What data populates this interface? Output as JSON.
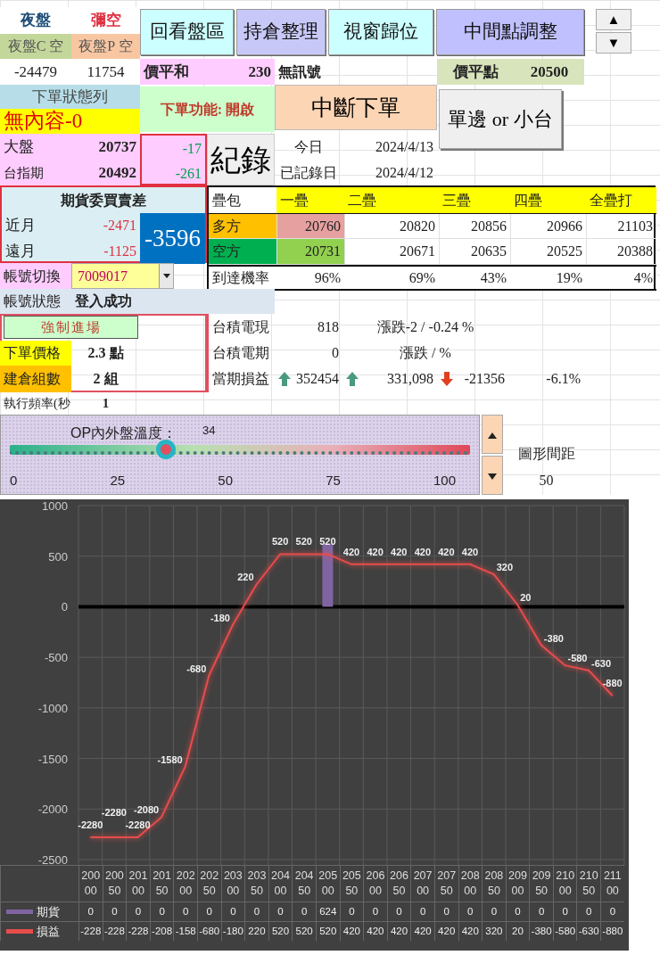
{
  "night_panel": {
    "title": "夜盤",
    "status": "彌空",
    "call_label": "夜盤C 空",
    "put_label": "夜盤P 空",
    "call_value": "-24479",
    "put_value": "11754"
  },
  "toolbar_buttons": [
    "回看盤區",
    "持倉整理",
    "視窗歸位",
    "中間點調整"
  ],
  "spin_buttons": [
    "▲",
    "▼"
  ],
  "atm_sum": {
    "label": "價平和",
    "value": "230"
  },
  "signal": "無訊號",
  "atm_strike": {
    "label": "價平點",
    "value": "20500"
  },
  "order_status": {
    "title": "下單狀態列",
    "value": "無內容-0"
  },
  "order_function": "下單功能: 開啟",
  "stop_button": "中斷下單",
  "mode_button": "單邊 or 小台",
  "market": [
    {
      "label": "大盤",
      "value": "20737",
      "change": "-17"
    },
    {
      "label": "台指期",
      "value": "20492",
      "change": "-261"
    }
  ],
  "record_button": "紀錄",
  "dates": [
    {
      "label": "今日",
      "value": "2024/4/13"
    },
    {
      "label": "已記錄日",
      "value": "2024/4/12"
    }
  ],
  "bid_ask": {
    "title": "期貨委買賣差",
    "rows": [
      {
        "label": "近月",
        "value": "-2471"
      },
      {
        "label": "遠月",
        "value": "-1125"
      }
    ],
    "total": "-3596"
  },
  "layers": {
    "columns": [
      "疊包",
      "一疊",
      "二疊",
      "三疊",
      "四疊",
      "全疊打"
    ],
    "rows": [
      {
        "kind": "long",
        "label": "多方",
        "values": [
          "20760",
          "20820",
          "20856",
          "20966",
          "21103"
        ]
      },
      {
        "kind": "short",
        "label": "空方",
        "values": [
          "20731",
          "20671",
          "20635",
          "20525",
          "20388"
        ]
      },
      {
        "kind": "probability",
        "label": "到達機率",
        "values": [
          "96%",
          "69%",
          "43%",
          "19%",
          "4%"
        ]
      }
    ]
  },
  "account": {
    "switch_label": "帳號切換",
    "selected_account": "7009017",
    "status_label": "帳號狀態",
    "status": "登入成功"
  },
  "force_entry_button": "強制進場",
  "order_settings": [
    {
      "label": "下單價格",
      "value": "2.3 點"
    },
    {
      "label": "建倉組數",
      "value": "2 組"
    },
    {
      "label": "執行頻率(秒",
      "value": "1"
    }
  ],
  "stocks": [
    {
      "label": "台積電現",
      "value": "818",
      "change": "漲跌-2 / -0.24 %"
    },
    {
      "label": "台積電期",
      "value": "0",
      "change": "漲跌 /  %"
    }
  ],
  "period_pnl": {
    "label": "當期損益",
    "items": [
      {
        "kind": "up",
        "value": "352454"
      },
      {
        "kind": "up",
        "value": "331,098"
      },
      {
        "kind": "down",
        "value": "-21356"
      }
    ],
    "ratio": "-6.1%"
  },
  "temperature": {
    "title": "OP內外盤溫度：",
    "reading": "34",
    "level": 0.34,
    "ticks": [
      "0",
      "25",
      "50",
      "75",
      "100"
    ]
  },
  "chart_spacing": {
    "label": "圖形間距",
    "value": "50"
  },
  "chart": {
    "chart_data": {
      "type": "line",
      "categories": [
        "20000",
        "20050",
        "20100",
        "20150",
        "20200",
        "20250",
        "20300",
        "20350",
        "20400",
        "20450",
        "20500",
        "20550",
        "20600",
        "20650",
        "20700",
        "20750",
        "20800",
        "20850",
        "20900",
        "20950",
        "21000",
        "21050",
        "21100"
      ],
      "series": [
        {
          "name": "期貨",
          "type": "bar",
          "color": "#8064a2",
          "values": [
            0,
            0,
            0,
            0,
            0,
            0,
            0,
            0,
            0,
            0,
            624,
            0,
            0,
            0,
            0,
            0,
            0,
            0,
            0,
            0,
            0,
            0,
            0
          ]
        },
        {
          "name": "損益",
          "color": "#e84c4c",
          "values": [
            -2280,
            -2280,
            -2280,
            -2080,
            -1580,
            -680,
            -180,
            220,
            520,
            520,
            520,
            420,
            420,
            420,
            420,
            420,
            420,
            320,
            20,
            -380,
            -580,
            -630,
            -880
          ]
        }
      ],
      "ylim": [
        -2500,
        1000
      ],
      "grid": true,
      "legend": "bottom left",
      "yticks": [
        -2500,
        -2000,
        -1500,
        -1000,
        -500,
        0,
        500,
        1000
      ],
      "data_labels": true
    },
    "data_table": [
      {
        "cells": [
          "0",
          "0",
          "0",
          "0",
          "0",
          "0",
          "0",
          "0",
          "0",
          "0",
          "624",
          "0",
          "0",
          "0",
          "0",
          "0",
          "0",
          "0",
          "0",
          "0",
          "0",
          "0",
          "0"
        ]
      },
      {
        "cells": [
          "-228",
          "-228",
          "-228",
          "-208",
          "-158",
          "-680",
          "-180",
          "220",
          "520",
          "520",
          "520",
          "420",
          "420",
          "420",
          "420",
          "420",
          "420",
          "320",
          "20",
          "-380",
          "-580",
          "-630",
          "-880"
        ]
      }
    ]
  }
}
